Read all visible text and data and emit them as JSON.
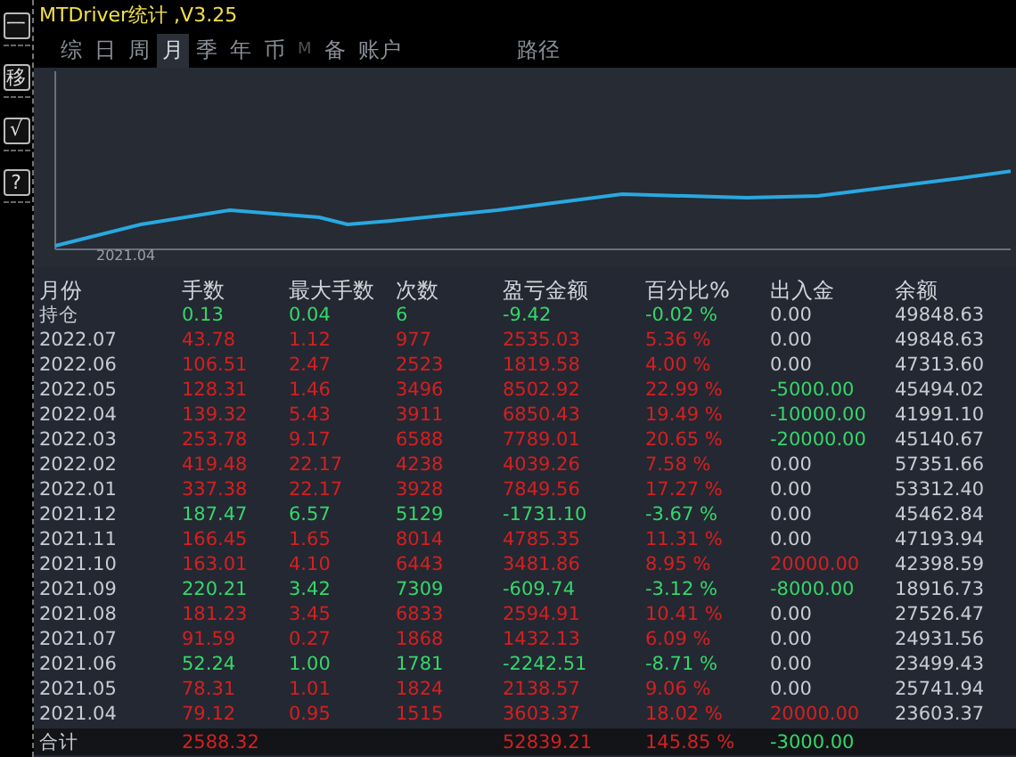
{
  "window": {
    "title": "MTDriver统计 ,V3.25"
  },
  "side_buttons": [
    "一",
    "移",
    "√",
    "?"
  ],
  "tabs": [
    {
      "label": "综",
      "selected": false,
      "disabled": false
    },
    {
      "label": "日",
      "selected": false,
      "disabled": false
    },
    {
      "label": "周",
      "selected": false,
      "disabled": false
    },
    {
      "label": "月",
      "selected": true,
      "disabled": false
    },
    {
      "label": "季",
      "selected": false,
      "disabled": false
    },
    {
      "label": "年",
      "selected": false,
      "disabled": false
    },
    {
      "label": "币",
      "selected": false,
      "disabled": false
    },
    {
      "label": "M",
      "selected": false,
      "disabled": true
    },
    {
      "label": "备",
      "selected": false,
      "disabled": false
    },
    {
      "label": "账户",
      "selected": false,
      "disabled": false
    }
  ],
  "path_tab": {
    "label": "路径",
    "selected": false
  },
  "chart": {
    "x_label": "2021.04"
  },
  "table": {
    "columns": [
      "月份",
      "手数",
      "最大手数",
      "次数",
      "盈亏金额",
      "百分比%",
      "出入金",
      "余额"
    ],
    "rows": [
      {
        "cells": [
          "持仓",
          "0.13",
          "0.04",
          "6",
          "-9.42",
          "-0.02 %",
          "0.00",
          "49848.63"
        ],
        "loss": true,
        "deposit": false,
        "withdrawal": false
      },
      {
        "cells": [
          "2022.07",
          "43.78",
          "1.12",
          "977",
          "2535.03",
          "5.36 %",
          "0.00",
          "49848.63"
        ],
        "loss": false,
        "deposit": false,
        "withdrawal": false
      },
      {
        "cells": [
          "2022.06",
          "106.51",
          "2.47",
          "2523",
          "1819.58",
          "4.00 %",
          "0.00",
          "47313.60"
        ],
        "loss": false,
        "deposit": false,
        "withdrawal": false
      },
      {
        "cells": [
          "2022.05",
          "128.31",
          "1.46",
          "3496",
          "8502.92",
          "22.99 %",
          "-5000.00",
          "45494.02"
        ],
        "loss": false,
        "deposit": false,
        "withdrawal": true
      },
      {
        "cells": [
          "2022.04",
          "139.32",
          "5.43",
          "3911",
          "6850.43",
          "19.49 %",
          "-10000.00",
          "41991.10"
        ],
        "loss": false,
        "deposit": false,
        "withdrawal": true
      },
      {
        "cells": [
          "2022.03",
          "253.78",
          "9.17",
          "6588",
          "7789.01",
          "20.65 %",
          "-20000.00",
          "45140.67"
        ],
        "loss": false,
        "deposit": false,
        "withdrawal": true
      },
      {
        "cells": [
          "2022.02",
          "419.48",
          "22.17",
          "4238",
          "4039.26",
          "7.58 %",
          "0.00",
          "57351.66"
        ],
        "loss": false,
        "deposit": false,
        "withdrawal": false
      },
      {
        "cells": [
          "2022.01",
          "337.38",
          "22.17",
          "3928",
          "7849.56",
          "17.27 %",
          "0.00",
          "53312.40"
        ],
        "loss": false,
        "deposit": false,
        "withdrawal": false
      },
      {
        "cells": [
          "2021.12",
          "187.47",
          "6.57",
          "5129",
          "-1731.10",
          "-3.67 %",
          "0.00",
          "45462.84"
        ],
        "loss": true,
        "deposit": false,
        "withdrawal": false
      },
      {
        "cells": [
          "2021.11",
          "166.45",
          "1.65",
          "8014",
          "4785.35",
          "11.31 %",
          "0.00",
          "47193.94"
        ],
        "loss": false,
        "deposit": false,
        "withdrawal": false
      },
      {
        "cells": [
          "2021.10",
          "163.01",
          "4.10",
          "6443",
          "3481.86",
          "8.95 %",
          "20000.00",
          "42398.59"
        ],
        "loss": false,
        "deposit": true,
        "withdrawal": false
      },
      {
        "cells": [
          "2021.09",
          "220.21",
          "3.42",
          "7309",
          "-609.74",
          "-3.12 %",
          "-8000.00",
          "18916.73"
        ],
        "loss": true,
        "deposit": false,
        "withdrawal": true
      },
      {
        "cells": [
          "2021.08",
          "181.23",
          "3.45",
          "6833",
          "2594.91",
          "10.41 %",
          "0.00",
          "27526.47"
        ],
        "loss": false,
        "deposit": false,
        "withdrawal": false
      },
      {
        "cells": [
          "2021.07",
          "91.59",
          "0.27",
          "1868",
          "1432.13",
          "6.09 %",
          "0.00",
          "24931.56"
        ],
        "loss": false,
        "deposit": false,
        "withdrawal": false
      },
      {
        "cells": [
          "2021.06",
          "52.24",
          "1.00",
          "1781",
          "-2242.51",
          "-8.71 %",
          "0.00",
          "23499.43"
        ],
        "loss": true,
        "deposit": false,
        "withdrawal": false
      },
      {
        "cells": [
          "2021.05",
          "78.31",
          "1.01",
          "1824",
          "2138.57",
          "9.06 %",
          "0.00",
          "25741.94"
        ],
        "loss": false,
        "deposit": false,
        "withdrawal": false
      },
      {
        "cells": [
          "2021.04",
          "79.12",
          "0.95",
          "1515",
          "3603.37",
          "18.02 %",
          "20000.00",
          "23603.37"
        ],
        "loss": false,
        "deposit": true,
        "withdrawal": false
      }
    ],
    "total": {
      "cells": [
        "合计",
        "2588.32",
        "",
        "",
        "52839.21",
        "145.85 %",
        "-3000.00",
        ""
      ],
      "loss": false,
      "deposit": false,
      "withdrawal": true
    }
  }
}
